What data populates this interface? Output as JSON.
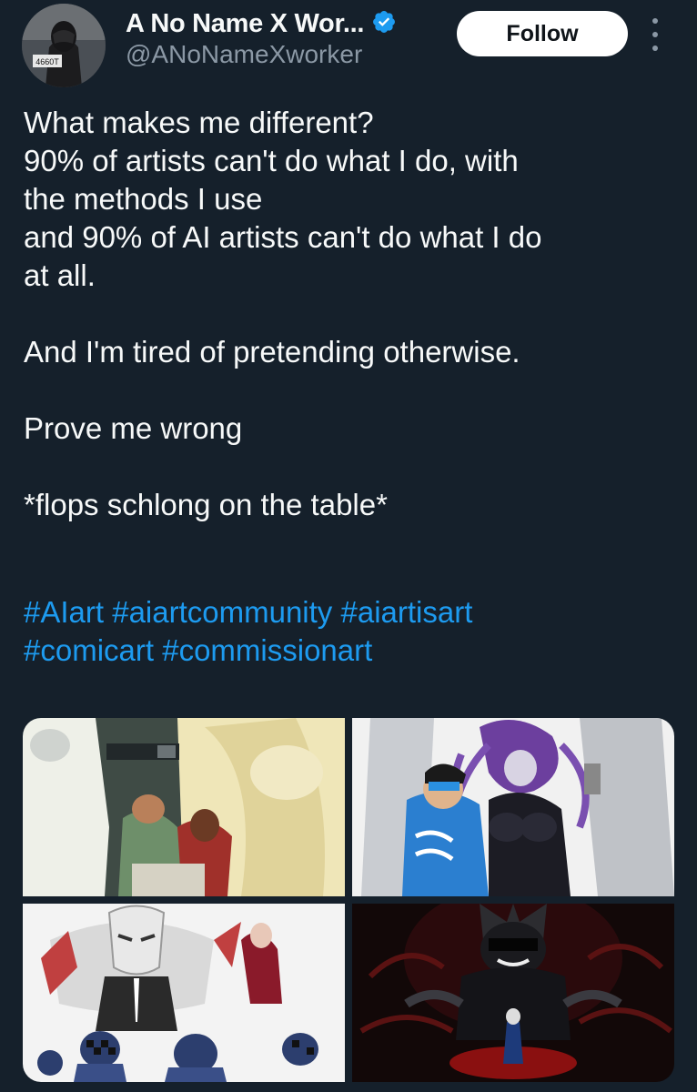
{
  "author": {
    "display_name": "A No Name X Wor...",
    "handle": "@ANoNameXworker",
    "avatar_badge_text": "4660T",
    "verified": true,
    "accent_color": "#1d9bf0"
  },
  "actions": {
    "follow_label": "Follow",
    "more_icon": "more-dots-vertical-icon"
  },
  "tweet": {
    "lines": [
      "What makes me different?",
      "90% of artists can't do what I do, with",
      "the methods I use",
      "and 90% of AI artists can't do what I do",
      "at all.",
      "",
      "And I'm tired of pretending otherwise.",
      "",
      "Prove me wrong",
      "",
      "*flops schlong on the table*"
    ],
    "hashtag_lines": [
      [
        "#AIart",
        "#aiartcommunity",
        "#aiartisart"
      ],
      [
        "#comicart",
        "#commissionart"
      ]
    ]
  },
  "media": {
    "images": [
      {
        "name": "media-image-1"
      },
      {
        "name": "media-image-2"
      },
      {
        "name": "media-image-3"
      },
      {
        "name": "media-image-4"
      }
    ]
  }
}
